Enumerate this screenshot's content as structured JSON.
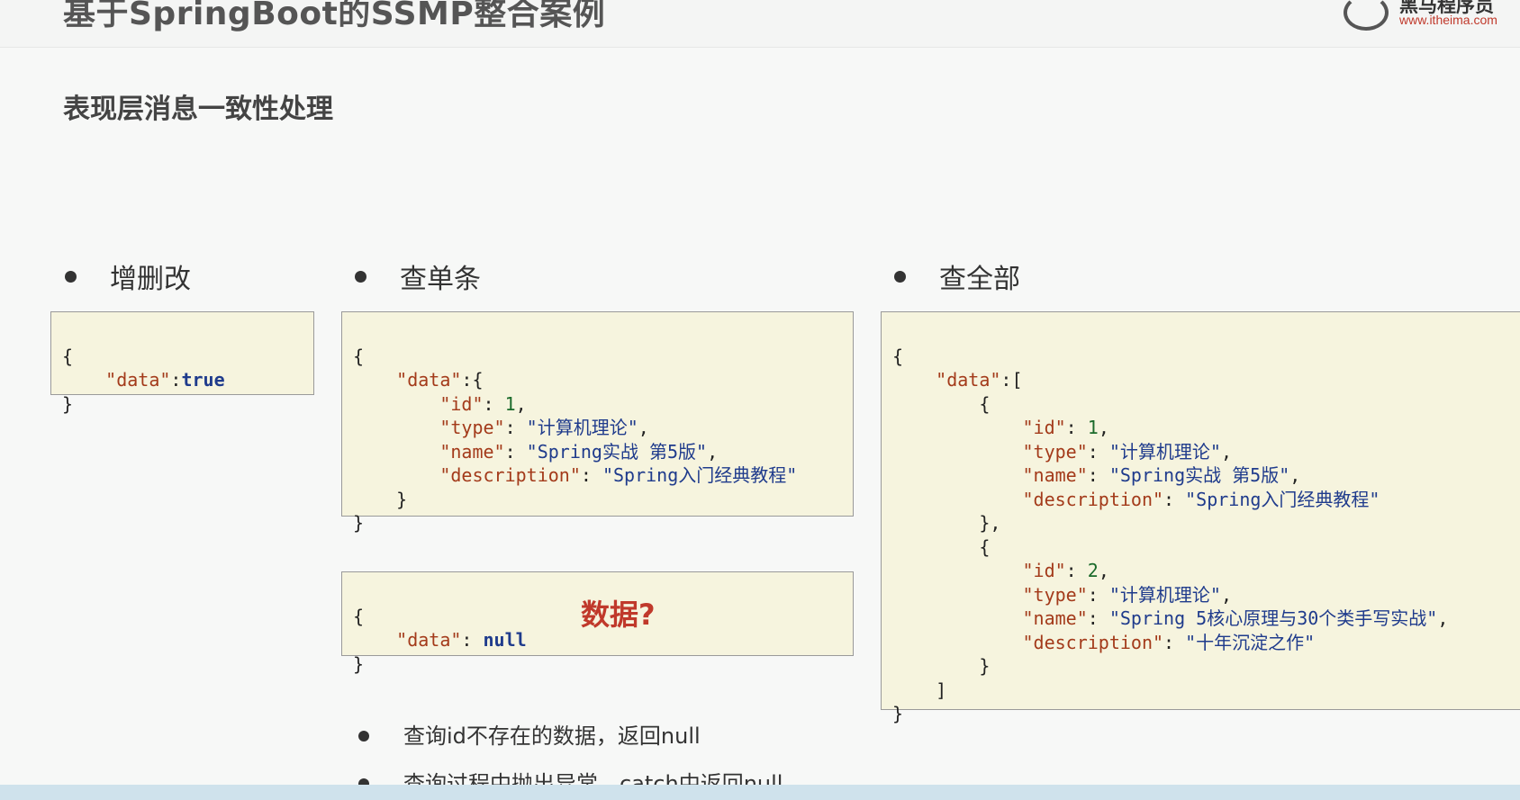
{
  "header": {
    "title": "基于SpringBoot的SSMP整合案例",
    "logo_name": "黑马程序员",
    "logo_url": "www.itheima.com"
  },
  "subtitle": "表现层消息一致性处理",
  "sections": [
    {
      "label": "增删改"
    },
    {
      "label": "查单条"
    },
    {
      "label": "查全部"
    }
  ],
  "code": {
    "write_result": [
      "{",
      "\"data\"",
      ":",
      "true",
      "}"
    ],
    "single": {
      "id": "1",
      "type": "\"计算机理论\"",
      "name": "\"Spring实战 第5版\"",
      "description": "\"Spring入门经典教程\""
    },
    "single_null": {
      "key": "\"data\"",
      "value": "null"
    },
    "list": [
      {
        "id": "1",
        "type": "\"计算机理论\"",
        "name": "\"Spring实战 第5版\"",
        "description": "\"Spring入门经典教程\""
      },
      {
        "id": "2",
        "type": "\"计算机理论\"",
        "name": "\"Spring 5核心原理与30个类手写实战\"",
        "description": "\"十年沉淀之作\""
      }
    ]
  },
  "annotation": "数据?",
  "notes": [
    "查询id不存在的数据，返回null",
    "查询过程中抛出异常，catch中返回null"
  ]
}
